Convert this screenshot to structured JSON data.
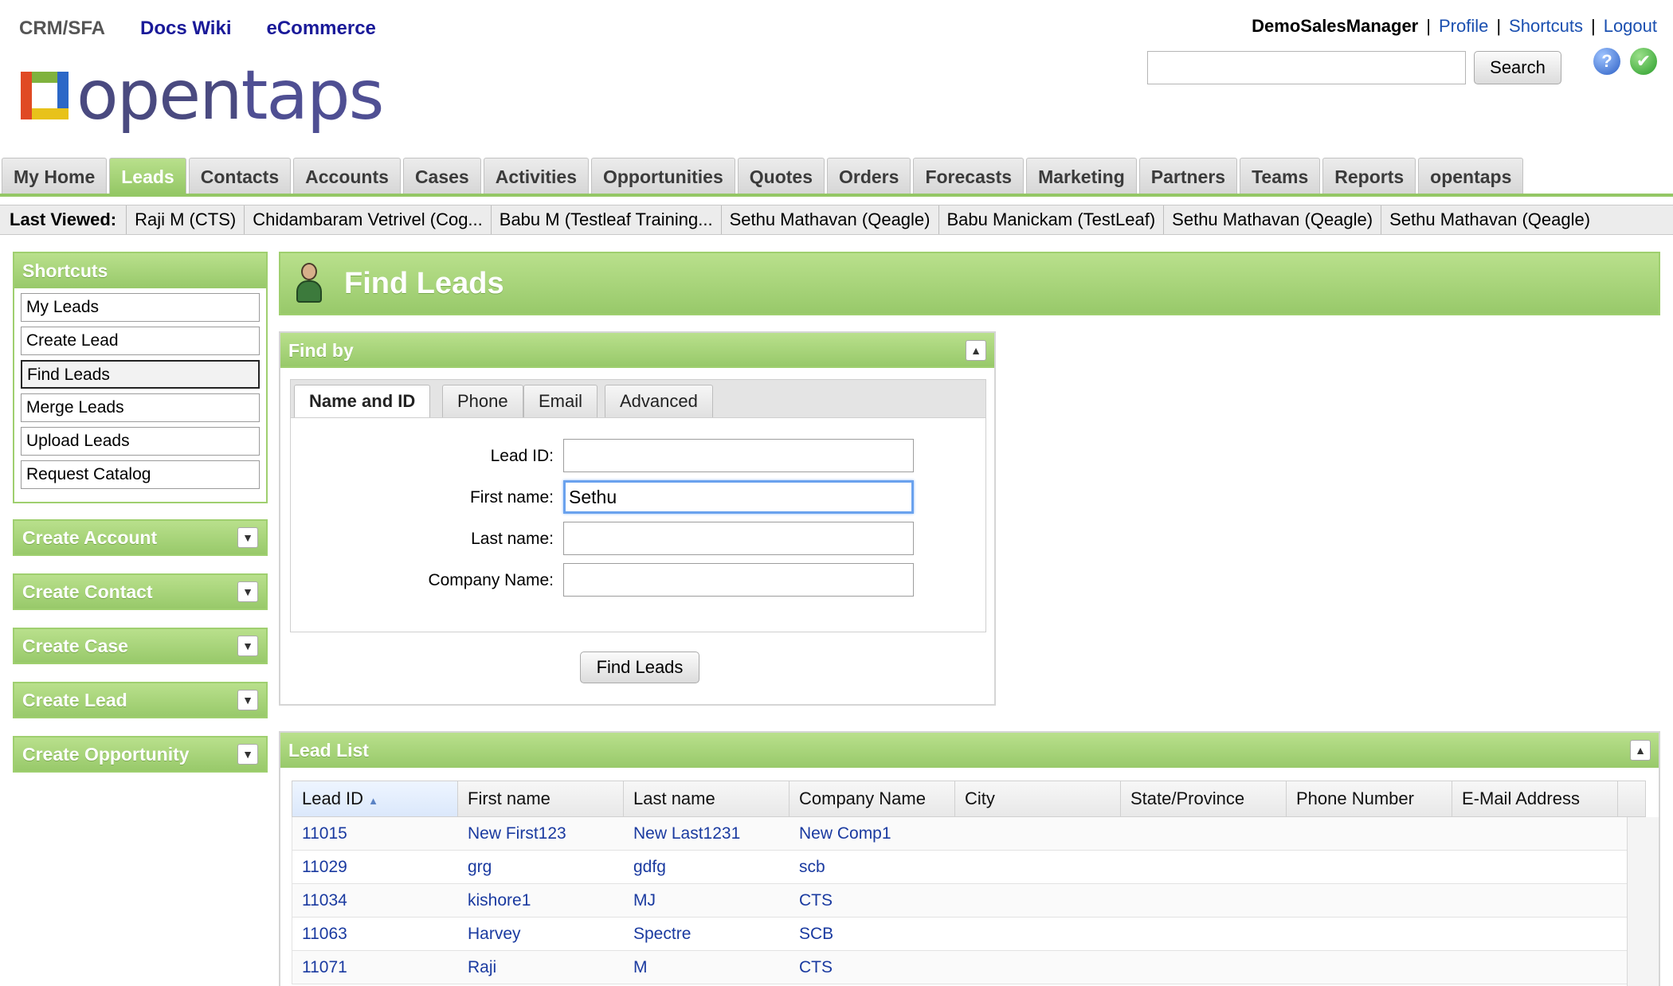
{
  "app_links": {
    "current": "CRM/SFA",
    "docs": "Docs Wiki",
    "ecommerce": "eCommerce"
  },
  "logo": {
    "text_part1": "open",
    "text_part2": "taps"
  },
  "user_bar": {
    "user": "DemoSalesManager",
    "profile": "Profile",
    "shortcuts": "Shortcuts",
    "logout": "Logout",
    "separator": "|"
  },
  "search": {
    "value": "",
    "button": "Search"
  },
  "icons": {
    "help": "?",
    "ok": "✔"
  },
  "tabs": [
    "My Home",
    "Leads",
    "Contacts",
    "Accounts",
    "Cases",
    "Activities",
    "Opportunities",
    "Quotes",
    "Orders",
    "Forecasts",
    "Marketing",
    "Partners",
    "Teams",
    "Reports",
    "opentaps"
  ],
  "active_tab": "Leads",
  "last_viewed": {
    "label": "Last Viewed:",
    "items": [
      "Raji M (CTS)",
      "Chidambaram Vetrivel (Cog...",
      "Babu M (Testleaf Training...",
      "Sethu Mathavan (Qeagle)",
      "Babu Manickam (TestLeaf)",
      "Sethu Mathavan (Qeagle)",
      "Sethu Mathavan (Qeagle)"
    ]
  },
  "sidebar": {
    "shortcuts_title": "Shortcuts",
    "shortcuts": [
      "My Leads",
      "Create Lead",
      "Find Leads",
      "Merge Leads",
      "Upload Leads",
      "Request Catalog"
    ],
    "selected": "Find Leads",
    "boxes": [
      "Create Account",
      "Create Contact",
      "Create Case",
      "Create Lead",
      "Create Opportunity"
    ]
  },
  "page": {
    "title": "Find Leads"
  },
  "find_by": {
    "title": "Find by",
    "tabs": [
      "Name and ID",
      "Phone",
      "Email",
      "Advanced"
    ],
    "active_tab": "Name and ID",
    "fields": [
      {
        "label": "Lead ID:",
        "value": ""
      },
      {
        "label": "First name:",
        "value": "Sethu"
      },
      {
        "label": "Last name:",
        "value": ""
      },
      {
        "label": "Company Name:",
        "value": ""
      }
    ],
    "button": "Find Leads"
  },
  "lead_list": {
    "title": "Lead List",
    "columns": [
      "Lead ID",
      "First name",
      "Last name",
      "Company Name",
      "City",
      "State/Province",
      "Phone Number",
      "E-Mail Address"
    ],
    "sort_column": "Lead ID",
    "rows": [
      [
        "11015",
        "New First123",
        "New Last1231",
        "New Comp1",
        "",
        "",
        "",
        ""
      ],
      [
        "11029",
        "grg",
        "gdfg",
        "scb",
        "",
        "",
        "",
        ""
      ],
      [
        "11034",
        "kishore1",
        "MJ",
        "CTS",
        "",
        "",
        "",
        ""
      ],
      [
        "11063",
        "Harvey",
        "Spectre",
        "SCB",
        "",
        "",
        "",
        ""
      ],
      [
        "11071",
        "Raji",
        "M",
        "CTS",
        "",
        "",
        "",
        ""
      ]
    ]
  },
  "colors": {
    "accent_green": "#94c765",
    "link_blue": "#1a3aa0",
    "header_link": "#1a1a99"
  }
}
